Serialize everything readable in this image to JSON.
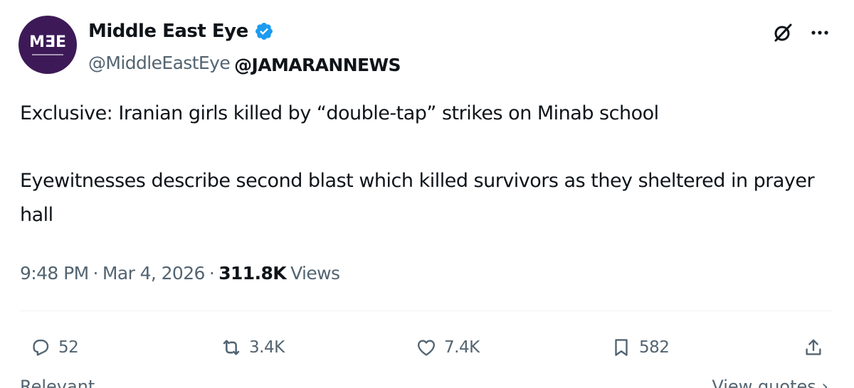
{
  "tweet": {
    "avatar": {
      "text": "M",
      "brand_color": "#3d1a57"
    },
    "author": {
      "display_name": "Middle East Eye",
      "handle": "@MiddleEastEye",
      "verified_color": "#1d9bf0"
    },
    "overlay_handle": "@JAMARANNEWS",
    "body": {
      "paragraph_1": "Exclusive: Iranian girls killed by “double-tap” strikes on Minab school",
      "paragraph_2": "Eyewitnesses describe second blast which killed survivors as they sheltered in prayer hall"
    },
    "meta": {
      "time": "9:48 PM",
      "separator": "·",
      "date": "Mar 4, 2026",
      "views_count": "311.8K",
      "views_label": "Views"
    },
    "actions": {
      "replies": "52",
      "reposts": "3.4K",
      "likes": "7.4K",
      "bookmarks": "582"
    },
    "footer": {
      "left": "Relevant",
      "right": "View quotes ›"
    },
    "icons": {
      "top_right_1": "grok-icon",
      "top_right_2": "more-icon",
      "reply": "reply-icon",
      "repost": "repost-icon",
      "like": "like-icon",
      "bookmark": "bookmark-icon",
      "share": "share-icon"
    }
  }
}
